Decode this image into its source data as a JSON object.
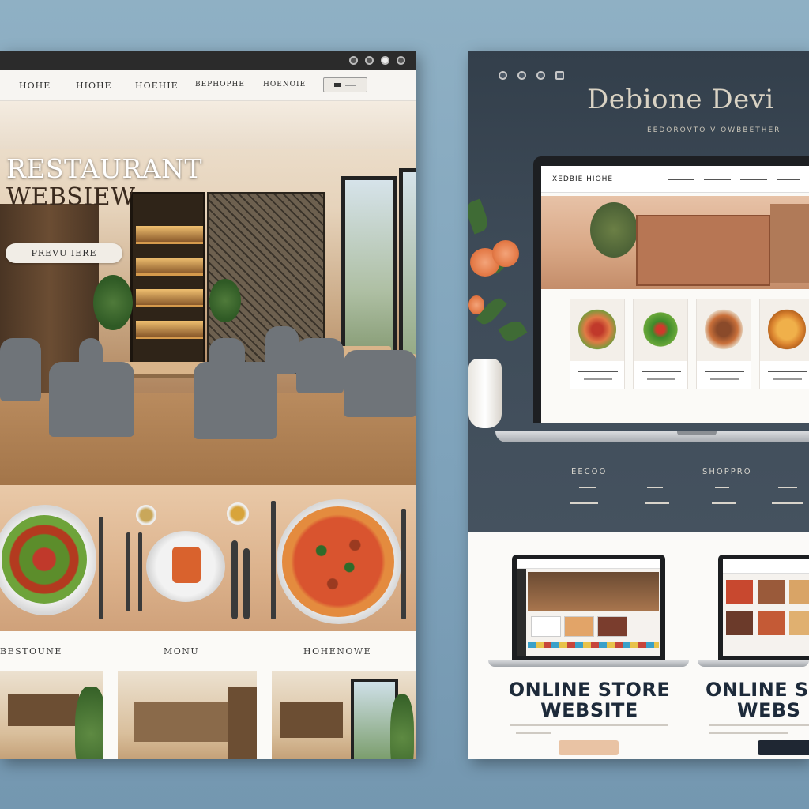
{
  "left": {
    "nav": [
      "HOHE",
      "HIOHE",
      "HOEHIE",
      "BEPHOPHE",
      "HOENOIE"
    ],
    "nav_button": "",
    "hero_title_1": "RESTAURANT",
    "hero_title_2": "WEBSIEW",
    "preview_button": "PREVU IERE",
    "sections": [
      "BESTOUNE",
      "MONU",
      "HOHENOWE"
    ],
    "thumb_buttons": [
      "",
      "",
      ""
    ]
  },
  "right": {
    "title": "Debione Devi",
    "subtitle": "EEDOROVTO V OWBBETHER",
    "laptop_nav": "XEDBIE HIOHE",
    "shop_heads": [
      "EECOO",
      "SHOPPRO"
    ],
    "shop_links_left": [
      "",
      ""
    ],
    "store_title_1": "ONLINE STORE",
    "store_title_2": "WEBSITE",
    "store_title_3": "ONLINE S",
    "store_title_4": "WEBS",
    "store_desc": "",
    "store_button_1": "",
    "store_button_2": ""
  },
  "colors": {
    "accent_peach": "#e7a48a",
    "dark_slate": "#3d4a57",
    "navy_text": "#1d2a3a"
  }
}
